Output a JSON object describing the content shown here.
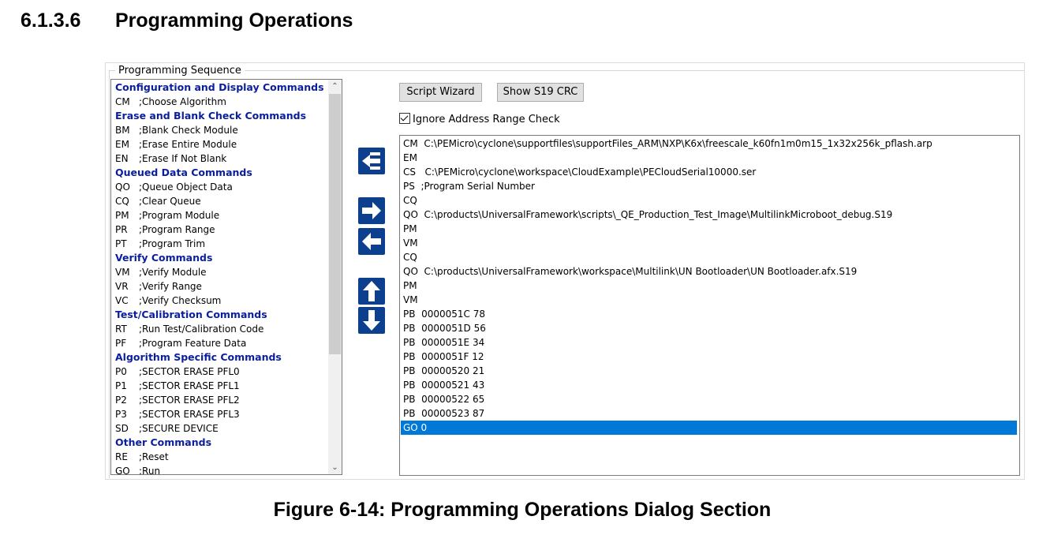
{
  "heading": {
    "number": "6.1.3.6",
    "title": "Programming Operations"
  },
  "caption": "Figure 6-14: Programming Operations Dialog Section",
  "group_label": "Programming Sequence",
  "buttons": {
    "script_wizard": "Script Wizard",
    "show_crc": "Show S19 CRC"
  },
  "ignore_check": {
    "label": "Ignore Address Range Check",
    "checked": true
  },
  "colors": {
    "category": "#0a1e9e",
    "arrow_button": "#0d3f8f",
    "selection": "#0078d7"
  },
  "icons": [
    "insert-arrow-icon",
    "arrow-right-icon",
    "arrow-left-icon",
    "arrow-up-icon",
    "arrow-down-icon",
    "chevron-up-icon",
    "chevron-down-icon"
  ],
  "command_list": [
    {
      "type": "category",
      "text": "Configuration and Display Commands"
    },
    {
      "type": "cmd",
      "code": "CM",
      "desc": ";Choose Algorithm"
    },
    {
      "type": "category",
      "text": "Erase and Blank Check Commands"
    },
    {
      "type": "cmd",
      "code": "BM",
      "desc": ";Blank Check Module"
    },
    {
      "type": "cmd",
      "code": "EM",
      "desc": ";Erase Entire Module"
    },
    {
      "type": "cmd",
      "code": "EN",
      "desc": ";Erase If Not Blank"
    },
    {
      "type": "category",
      "text": "Queued Data Commands"
    },
    {
      "type": "cmd",
      "code": "QO",
      "desc": ";Queue Object Data"
    },
    {
      "type": "cmd",
      "code": "CQ",
      "desc": ";Clear Queue"
    },
    {
      "type": "cmd",
      "code": "PM",
      "desc": ";Program Module"
    },
    {
      "type": "cmd",
      "code": "PR",
      "desc": ";Program Range"
    },
    {
      "type": "cmd",
      "code": "PT",
      "desc": ";Program Trim"
    },
    {
      "type": "category",
      "text": "Verify Commands"
    },
    {
      "type": "cmd",
      "code": "VM",
      "desc": ";Verify Module"
    },
    {
      "type": "cmd",
      "code": "VR",
      "desc": ";Verify Range"
    },
    {
      "type": "cmd",
      "code": "VC",
      "desc": ";Verify Checksum"
    },
    {
      "type": "category",
      "text": "Test/Calibration Commands"
    },
    {
      "type": "cmd",
      "code": "RT",
      "desc": ";Run Test/Calibration Code"
    },
    {
      "type": "cmd",
      "code": "PF",
      "desc": ";Program Feature Data"
    },
    {
      "type": "category",
      "text": "Algorithm Specific Commands"
    },
    {
      "type": "cmd",
      "code": "P0",
      "desc": ";SECTOR ERASE PFL0"
    },
    {
      "type": "cmd",
      "code": "P1",
      "desc": ";SECTOR ERASE PFL1"
    },
    {
      "type": "cmd",
      "code": "P2",
      "desc": ";SECTOR ERASE PFL2"
    },
    {
      "type": "cmd",
      "code": "P3",
      "desc": ";SECTOR ERASE PFL3"
    },
    {
      "type": "cmd",
      "code": "SD",
      "desc": ";SECURE DEVICE"
    },
    {
      "type": "category",
      "text": "Other Commands"
    },
    {
      "type": "cmd",
      "code": "RE",
      "desc": ";Reset"
    },
    {
      "type": "cmd",
      "code": "GO",
      "desc": ";Run"
    }
  ],
  "script_lines": [
    {
      "text": "CM  C:\\PEMicro\\cyclone\\supportfiles\\supportFiles_ARM\\NXP\\K6x\\freescale_k60fn1m0m15_1x32x256k_pflash.arp",
      "selected": false
    },
    {
      "text": "EM",
      "selected": false
    },
    {
      "text": "CS   C:\\PEMicro\\cyclone\\workspace\\CloudExample\\PECloudSerial10000.ser",
      "selected": false
    },
    {
      "text": "PS  ;Program Serial Number",
      "selected": false
    },
    {
      "text": "CQ",
      "selected": false
    },
    {
      "text": "QO  C:\\products\\UniversalFramework\\scripts\\_QE_Production_Test_Image\\MultilinkMicroboot_debug.S19",
      "selected": false
    },
    {
      "text": "PM",
      "selected": false
    },
    {
      "text": "VM",
      "selected": false
    },
    {
      "text": "CQ",
      "selected": false
    },
    {
      "text": "QO  C:\\products\\UniversalFramework\\workspace\\Multilink\\UN Bootloader\\UN Bootloader.afx.S19",
      "selected": false
    },
    {
      "text": "PM",
      "selected": false
    },
    {
      "text": "VM",
      "selected": false
    },
    {
      "text": "PB  0000051C 78",
      "selected": false
    },
    {
      "text": "PB  0000051D 56",
      "selected": false
    },
    {
      "text": "PB  0000051E 34",
      "selected": false
    },
    {
      "text": "PB  0000051F 12",
      "selected": false
    },
    {
      "text": "PB  00000520 21",
      "selected": false
    },
    {
      "text": "PB  00000521 43",
      "selected": false
    },
    {
      "text": "PB  00000522 65",
      "selected": false
    },
    {
      "text": "PB  00000523 87",
      "selected": false
    },
    {
      "text": "GO 0",
      "selected": true
    }
  ]
}
